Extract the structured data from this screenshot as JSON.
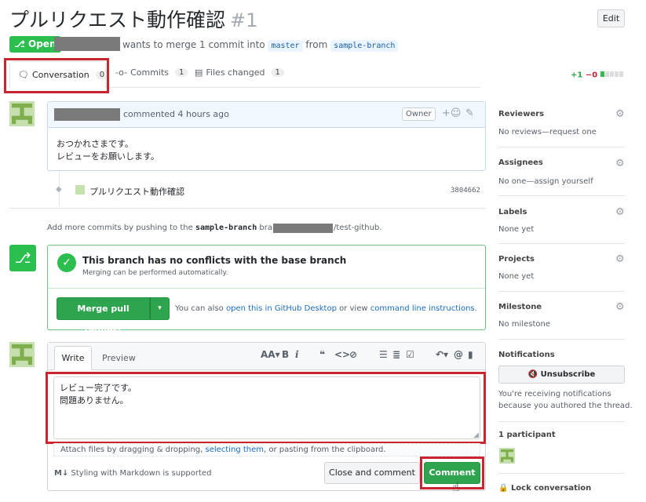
{
  "pr": {
    "title": "プルリクエスト動作確認",
    "number": "#1",
    "edit_label": "Edit",
    "state_label": "Open",
    "merge_text": "wants to merge 1 commit into",
    "base_branch": "master",
    "from_text": "from",
    "head_branch": "sample-branch"
  },
  "tabs": [
    {
      "label": "Conversation",
      "count": "0"
    },
    {
      "label": "Commits",
      "count": "1"
    },
    {
      "label": "Files changed",
      "count": "1"
    }
  ],
  "diffstat": {
    "add": "+1",
    "del": "−0"
  },
  "comment": {
    "action": "commented 4 hours ago",
    "owner_label": "Owner",
    "body_line1": "おつかれさまです。",
    "body_line2": "レビューをお願いします。"
  },
  "commit": {
    "message": "プルリクエスト動作確認",
    "sha": "3804662"
  },
  "push_hint": {
    "prefix": "Add more commits by pushing to the",
    "branch": "sample-branch",
    "mid": "branch on",
    "repo": "/test-github."
  },
  "merge": {
    "status_title": "This branch has no conflicts with the base branch",
    "status_sub": "Merging can be performed automatically.",
    "button_label": "Merge pull request",
    "also_text": "You can also",
    "desktop_link": "open this in GitHub Desktop",
    "or_text": "or view",
    "cli_link": "command line instructions",
    "period": "."
  },
  "editor": {
    "tab_write": "Write",
    "tab_preview": "Preview",
    "line1": "レビュー完了です。",
    "line2": "問題ありません。",
    "attach_prefix": "Attach files by dragging & dropping,",
    "attach_link": "selecting them",
    "attach_suffix": ", or pasting from the clipboard.",
    "markdown_hint": "Styling with Markdown is supported",
    "close_comment_label": "Close and comment",
    "comment_label": "Comment"
  },
  "sidebar": {
    "reviewers_title": "Reviewers",
    "reviewers_value": "No reviews—request one",
    "assignees_title": "Assignees",
    "assignees_value": "No one—assign yourself",
    "labels_title": "Labels",
    "labels_value": "None yet",
    "projects_title": "Projects",
    "projects_value": "None yet",
    "milestone_title": "Milestone",
    "milestone_value": "No milestone",
    "notifications_title": "Notifications",
    "unsubscribe_label": "Unsubscribe",
    "notif_reason_1": "You're receiving notifications",
    "notif_reason_2": "because you authored the thread.",
    "participants_title": "1 participant",
    "lock_label": "Lock conversation"
  },
  "colors": {
    "accent_green": "#2cbe4e",
    "highlight_red": "#cb2431",
    "link_blue": "#1a6ec0"
  }
}
